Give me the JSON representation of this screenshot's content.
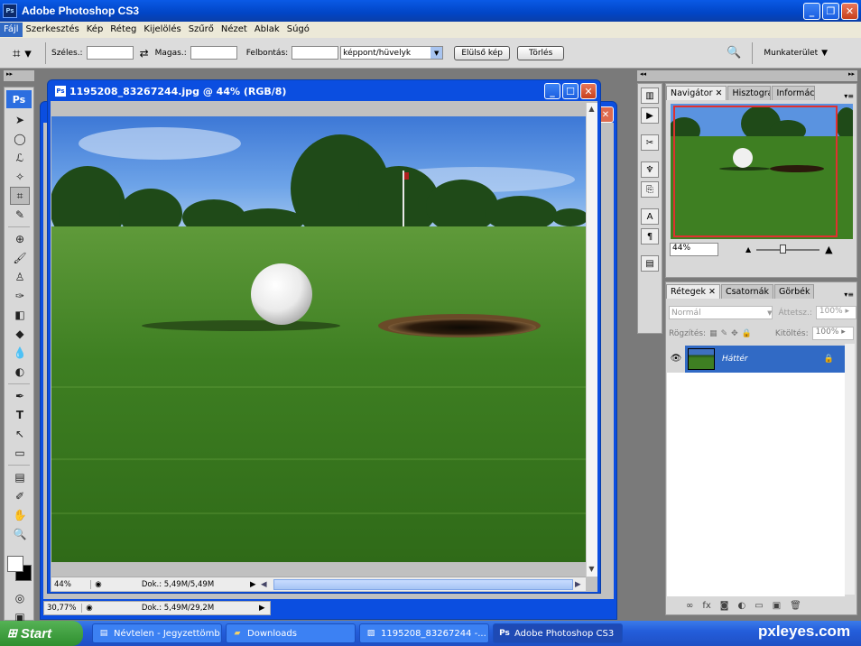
{
  "app": {
    "title": "Adobe Photoshop CS3",
    "logo": "Ps"
  },
  "menu": [
    "Fájl",
    "Szerkesztés",
    "Kép",
    "Réteg",
    "Kijelölés",
    "Szűrő",
    "Nézet",
    "Ablak",
    "Súgó"
  ],
  "options": {
    "width_label": "Széles.:",
    "height_label": "Magas.:",
    "resolution_label": "Felbontás:",
    "unit_value": "képpont/hüvelyk",
    "front_image_btn": "Elülső kép",
    "clear_btn": "Törlés",
    "workspace_label": "Munkaterület"
  },
  "toolbox": {
    "logo": "Ps"
  },
  "document": {
    "title": "1195208_83267244.jpg @ 44% (RGB/8)",
    "zoom": "44%",
    "doc_info": "Dok.: 5,49M/5,49M"
  },
  "document2": {
    "zoom": "30,77%",
    "doc_info": "Dok.: 5,49M/29,2M"
  },
  "navigator": {
    "tabs": [
      "Navigátor",
      "Hisztogram",
      "Információ"
    ],
    "zoom": "44%"
  },
  "layers": {
    "tabs": [
      "Rétegek",
      "Csatornák",
      "Görbék"
    ],
    "blend_mode": "Normál",
    "opacity_label": "Áttetsz.:",
    "opacity_value": "100%",
    "lock_label": "Rögzítés:",
    "fill_label": "Kitöltés:",
    "fill_value": "100%",
    "layer_name": "Háttér"
  },
  "taskbar": {
    "start": "Start",
    "items": [
      "Névtelen - Jegyzettömb",
      "Downloads",
      "1195208_83267244 -...",
      "Adobe Photoshop CS3"
    ]
  },
  "watermark": "pxleyes.com",
  "colors": {
    "xp_blue": "#0b4ee0",
    "selected_layer": "#316ac5",
    "nav_frame": "#e03030"
  }
}
